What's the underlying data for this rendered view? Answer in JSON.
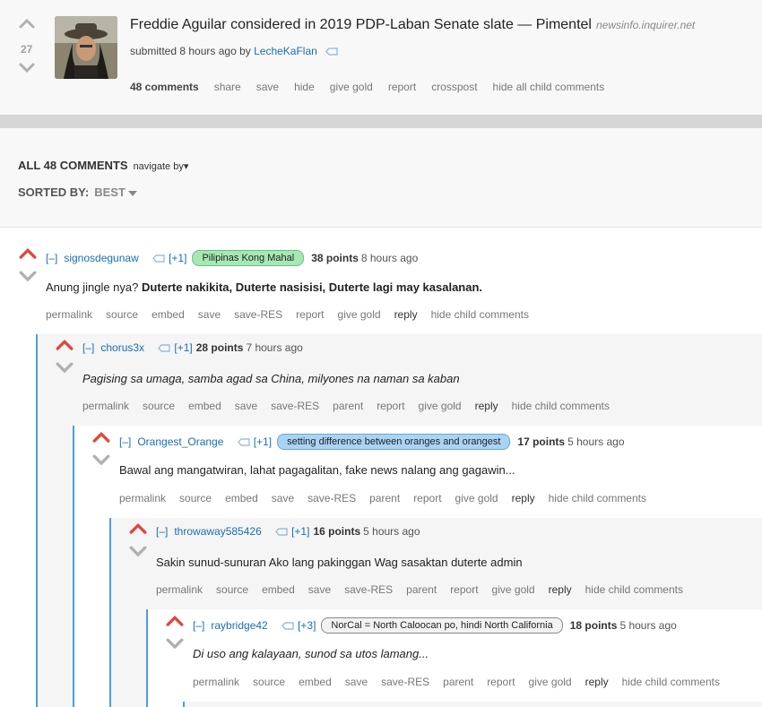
{
  "post": {
    "score": "27",
    "title": "Freddie Aguilar considered in 2019 PDP-Laban Senate slate — Pimentel",
    "domain": "newsinfo.inquirer.net",
    "submitted_prefix": "submitted 8 hours ago by",
    "author": "LecheKaFlan",
    "buttons": [
      "48 comments",
      "share",
      "save",
      "hide",
      "give gold",
      "report",
      "crosspost",
      "hide all child comments"
    ]
  },
  "comments_header": {
    "title": "ALL 48 COMMENTS",
    "navigate": "navigate by",
    "sorted_label": "SORTED BY:",
    "sorted_value": "BEST"
  },
  "comments": [
    {
      "collapse": "[–]",
      "author": "signosdegunaw",
      "karma": "[+1]",
      "flair": "Pilipinas Kong Mahal",
      "points": "38 points",
      "time": "8 hours ago",
      "body_prefix": "Anung jingle nya? ",
      "body_bold": "Duterte nakikita, Duterte nasisisi, Duterte lagi may kasalanan.",
      "buttons": [
        "permalink",
        "source",
        "embed",
        "save",
        "save-RES",
        "report",
        "give gold",
        "reply",
        "hide child comments"
      ]
    },
    {
      "collapse": "[–]",
      "author": "chorus3x",
      "karma": "[+1]",
      "points": "28 points",
      "time": "7 hours ago",
      "body": "Pagising sa umaga, samba agad sa China, milyones na naman sa kaban",
      "buttons": [
        "permalink",
        "source",
        "embed",
        "save",
        "save-RES",
        "parent",
        "report",
        "give gold",
        "reply",
        "hide child comments"
      ]
    },
    {
      "collapse": "[–]",
      "author": "Orangest_Orange",
      "karma": "[+1]",
      "flair": "setting difference between oranges and orangest",
      "points": "17 points",
      "time": "5 hours ago",
      "body": "Bawal ang mangatwiran, lahat pagagalitan, fake news nalang ang gagawin...",
      "buttons": [
        "permalink",
        "source",
        "embed",
        "save",
        "save-RES",
        "parent",
        "report",
        "give gold",
        "reply",
        "hide child comments"
      ]
    },
    {
      "collapse": "[–]",
      "author": "throwaway585426",
      "karma": "[+1]",
      "points": "16 points",
      "time": "5 hours ago",
      "body": "Sakin sunud-sunuran Ako lang pakinggan Wag sasaktan duterte admin",
      "buttons": [
        "permalink",
        "source",
        "embed",
        "save",
        "save-RES",
        "parent",
        "report",
        "give gold",
        "reply",
        "hide child comments"
      ]
    },
    {
      "collapse": "[–]",
      "author": "raybridge42",
      "karma": "[+3]",
      "flair": "NorCal = North Caloocan po, hindi North California",
      "points": "18 points",
      "time": "5 hours ago",
      "body": "Di uso ang kalayaan, sunod sa utos lamang...",
      "buttons": [
        "permalink",
        "source",
        "embed",
        "save",
        "save-RES",
        "parent",
        "report",
        "give gold",
        "reply",
        "hide child comments"
      ]
    }
  ],
  "colors": {
    "upvote_active": "#e0473a",
    "arrow_gray": "#b0b0b0",
    "link_blue": "#1a6fb0",
    "thread_line": "#4c9ed9"
  }
}
